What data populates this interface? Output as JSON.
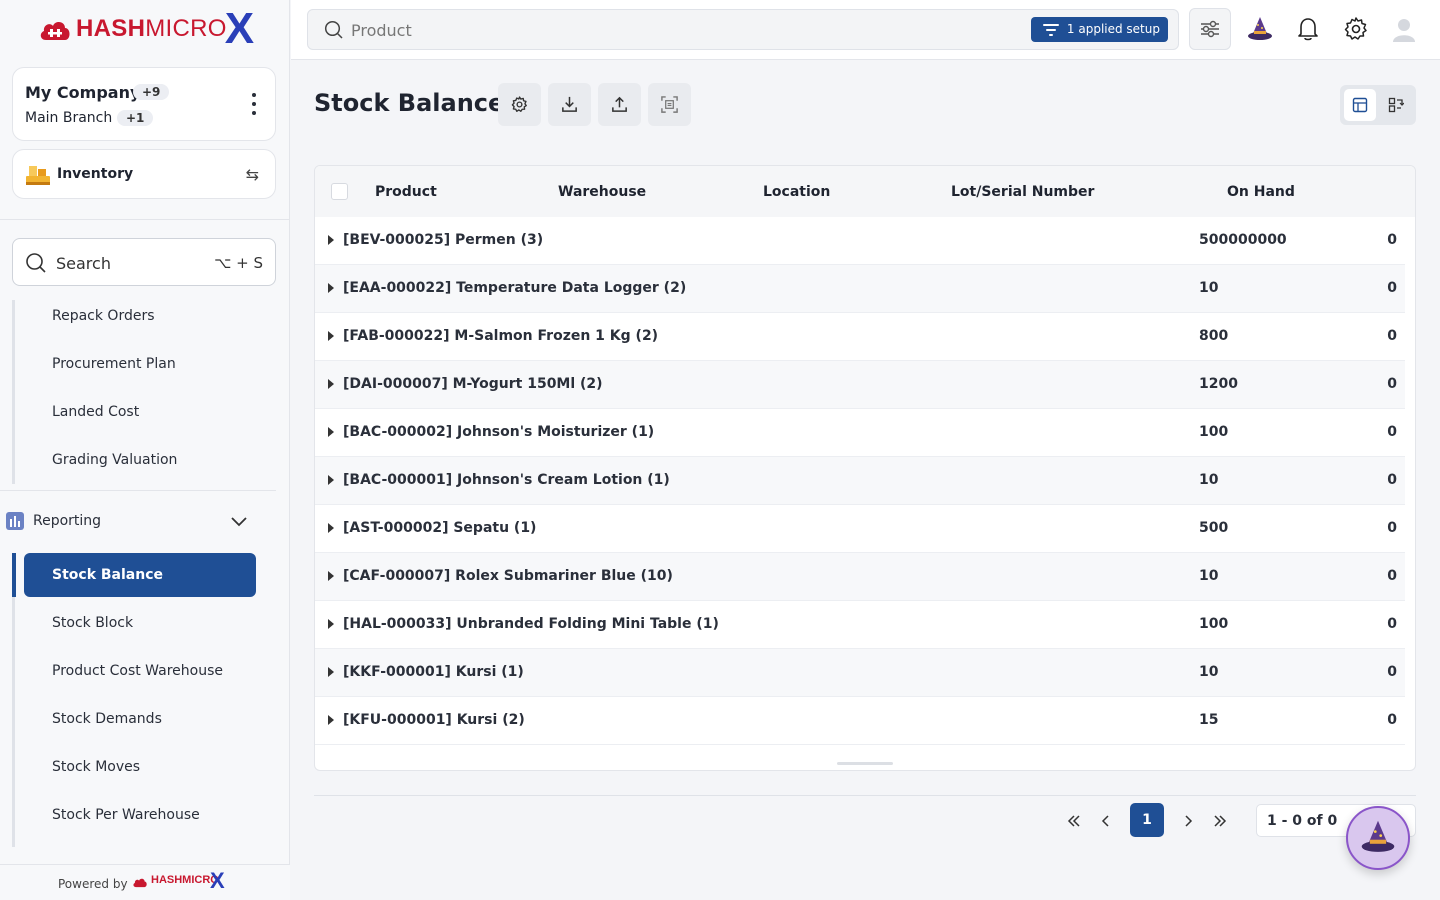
{
  "brand": {
    "name_bold": "HASH",
    "name_thin": "MICRO",
    "x": "X"
  },
  "company": {
    "name": "My Company",
    "count": "+9",
    "branch": "Main Branch",
    "branch_count": "+1"
  },
  "module": {
    "label": "Inventory"
  },
  "sidebar_search": {
    "label": "Search",
    "shortcut": "⌥ + S"
  },
  "menu": {
    "items_top": [
      "Repack Orders",
      "Procurement Plan",
      "Landed Cost",
      "Grading Valuation"
    ],
    "section": "Reporting",
    "active": "Stock Balance",
    "items_bottom": [
      "Stock Block",
      "Product Cost Warehouse",
      "Stock Demands",
      "Stock Moves",
      "Stock Per Warehouse"
    ]
  },
  "powered_by": {
    "label": "Powered by",
    "brand": "HASHMICRO",
    "x": "X"
  },
  "topbar": {
    "search_placeholder": "Product",
    "applied_setup": "1 applied setup"
  },
  "colors": {
    "primary": "#1f4f95",
    "brand_red": "#c8182f",
    "brand_blue": "#2a3fb8"
  },
  "page": {
    "title": "Stock Balance"
  },
  "table": {
    "columns": [
      "Product",
      "Warehouse",
      "Location",
      "Lot/Serial Number",
      "On Hand"
    ],
    "rows": [
      {
        "name": "[BEV-000025] Permen (3)",
        "qty": "500000000",
        "last": "0"
      },
      {
        "name": "[EAA-000022] Temperature Data Logger (2)",
        "qty": "10",
        "last": "0"
      },
      {
        "name": "[FAB-000022] M-Salmon Frozen 1 Kg (2)",
        "qty": "800",
        "last": "0"
      },
      {
        "name": "[DAI-000007] M-Yogurt 150Ml (2)",
        "qty": "1200",
        "last": "0"
      },
      {
        "name": "[BAC-000002] Johnson's Moisturizer (1)",
        "qty": "100",
        "last": "0"
      },
      {
        "name": "[BAC-000001] Johnson's Cream Lotion (1)",
        "qty": "10",
        "last": "0"
      },
      {
        "name": "[AST-000002] Sepatu (1)",
        "qty": "500",
        "last": "0"
      },
      {
        "name": "[CAF-000007] Rolex Submariner Blue (10)",
        "qty": "10",
        "last": "0"
      },
      {
        "name": "[HAL-000033] Unbranded Folding Mini Table (1)",
        "qty": "100",
        "last": "0"
      },
      {
        "name": "[KKF-000001] Kursi (1)",
        "qty": "10",
        "last": "0"
      },
      {
        "name": "[KFU-000001] Kursi (2)",
        "qty": "15",
        "last": "0"
      }
    ]
  },
  "pagination": {
    "current_page": "1",
    "range": "1 - 0  of 0"
  }
}
